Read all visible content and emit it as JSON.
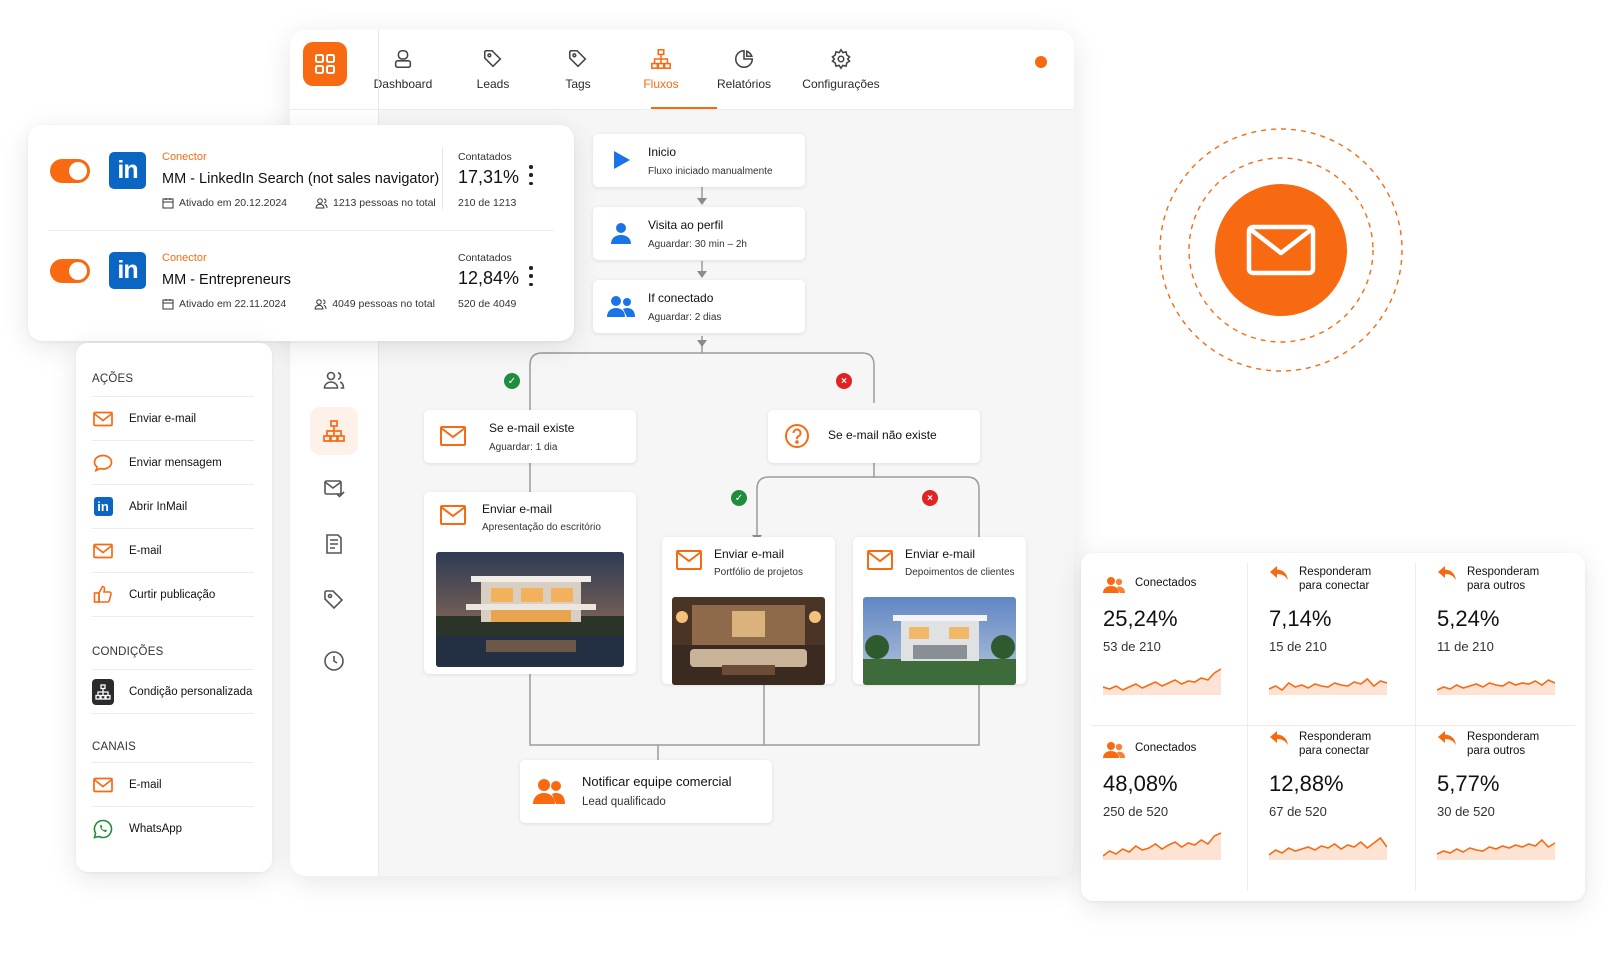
{
  "nav": {
    "tabs": [
      {
        "label": "Dashboard",
        "icon": "user-icon"
      },
      {
        "label": "Leads",
        "icon": "tag-icon"
      },
      {
        "label": "Tags",
        "icon": "tag-icon"
      },
      {
        "label": "Fluxos",
        "icon": "flow-icon",
        "active": true
      },
      {
        "label": "Relatórios",
        "icon": "pie-chart-icon"
      },
      {
        "label": "Configurações",
        "icon": "gear-icon"
      }
    ],
    "status_dot_color": "#f86a12"
  },
  "connectors": [
    {
      "tag": "Conector",
      "name": "MM - LinkedIn Search (not sales navigator)",
      "activated": "Ativado em 20.12.2024",
      "people": "1213 pessoas no total",
      "stat_label": "Contatados",
      "stat_pct": "17,31%",
      "stat_count": "210 de 1213",
      "logo": "in",
      "enabled": true
    },
    {
      "tag": "Conector",
      "name": "MM - Entrepreneurs",
      "activated": "Ativado em 22.11.2024",
      "people": "4049 pessoas no total",
      "stat_label": "Contatados",
      "stat_pct": "12,84%",
      "stat_count": "520 de 4049",
      "logo": "in",
      "enabled": true
    }
  ],
  "actions_panel": {
    "sections": [
      {
        "title": "AÇÕES",
        "items": [
          {
            "label": "Enviar e-mail",
            "icon": "mail-icon"
          },
          {
            "label": "Enviar mensagem",
            "icon": "chat-bubble-icon"
          },
          {
            "label": "Abrir InMail",
            "icon": "linkedin-icon"
          },
          {
            "label": "E-mail",
            "icon": "mail-icon"
          },
          {
            "label": "Curtir publicação",
            "icon": "thumbs-up-icon"
          }
        ]
      },
      {
        "title": "CONDIÇÕES",
        "items": [
          {
            "label": "Condição personalizada",
            "icon": "hierarchy-icon"
          }
        ]
      },
      {
        "title": "CANAIS",
        "items": [
          {
            "label": "E-mail",
            "icon": "mail-icon"
          },
          {
            "label": "WhatsApp",
            "icon": "whatsapp-icon"
          }
        ]
      }
    ]
  },
  "flow": {
    "start": {
      "title": "Inicio",
      "subtitle": "Fluxo iniciado manualmente"
    },
    "visit": {
      "title": "Visita ao perfil",
      "subtitle": "Aguardar: 30 min – 2h"
    },
    "if_connected": {
      "title": "If conectado",
      "subtitle": "Aguardar: 2 dias"
    },
    "email_exists": {
      "title": "Se e-mail existe",
      "subtitle": "Aguardar: 1 dia"
    },
    "email_not_exists": {
      "title": "Se e-mail não existe"
    },
    "send_office": {
      "title": "Enviar e-mail",
      "subtitle": "Apresentação do escritório"
    },
    "send_portfolio": {
      "title": "Enviar e-mail",
      "subtitle": "Portfólio de projetos"
    },
    "send_testimonials": {
      "title": "Enviar e-mail",
      "subtitle": "Depoimentos de clientes"
    },
    "notify": {
      "title": "Notificar equipe comercial",
      "subtitle": "Lead qualificado"
    }
  },
  "stats": {
    "cells": [
      {
        "header": [
          "Conectados"
        ],
        "icon": "users-icon",
        "pct": "25,24%",
        "count": "53 de 210"
      },
      {
        "header": [
          "Responderam",
          "para conectar"
        ],
        "icon": "reply-icon",
        "pct": "7,14%",
        "count": "15 de 210"
      },
      {
        "header": [
          "Responderam",
          "para outros"
        ],
        "icon": "reply-icon",
        "pct": "5,24%",
        "count": "11 de 210"
      },
      {
        "header": [
          "Conectados"
        ],
        "icon": "users-icon",
        "pct": "48,08%",
        "count": "250 de 520"
      },
      {
        "header": [
          "Responderam",
          "para conectar"
        ],
        "icon": "reply-icon",
        "pct": "12,88%",
        "count": "67 de 520"
      },
      {
        "header": [
          "Responderam",
          "para outros"
        ],
        "icon": "reply-icon",
        "pct": "5,77%",
        "count": "30 de 520"
      }
    ],
    "accent": "#f86a12"
  },
  "colors": {
    "accent": "#f86a12",
    "linkedin": "#0a66c2",
    "ok": "#1e8e3e",
    "no": "#e02424",
    "play": "#1a73e8"
  }
}
